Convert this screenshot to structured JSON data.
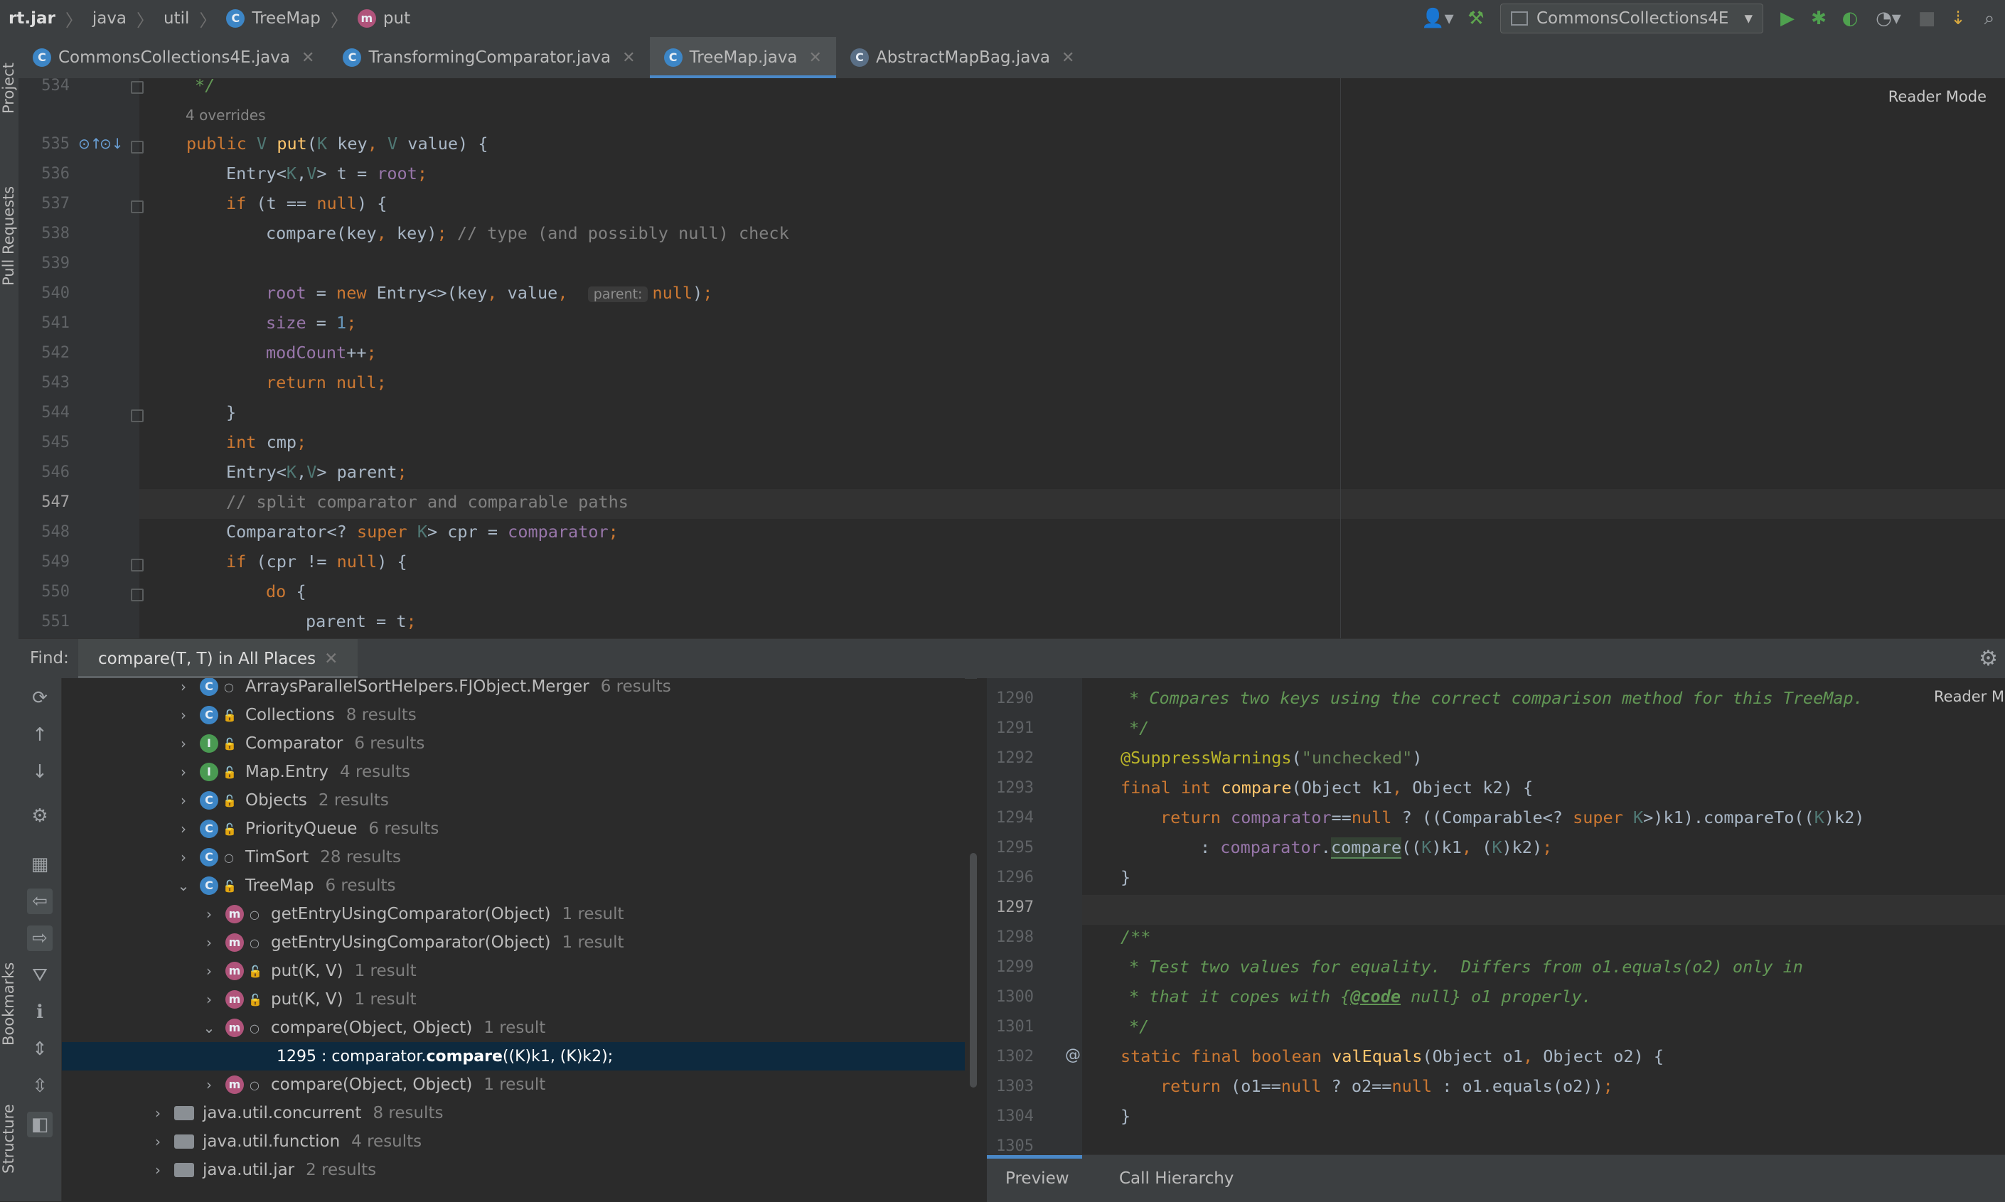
{
  "breadcrumbs": [
    "rt.jar",
    "java",
    "util",
    "TreeMap",
    "put"
  ],
  "breadcrumb_icons": {
    "TreeMap": "C",
    "put": "m"
  },
  "run_config": "CommonsCollections4E",
  "left_strip": {
    "project": "Project",
    "pull_requests": "Pull Requests",
    "bookmarks": "Bookmarks",
    "structure": "Structure"
  },
  "tabs": [
    {
      "label": "CommonsCollections4E.java",
      "active": false
    },
    {
      "label": "TransformingComparator.java",
      "active": false
    },
    {
      "label": "TreeMap.java",
      "active": true
    },
    {
      "label": "AbstractMapBag.java",
      "active": false
    }
  ],
  "editor": {
    "reader_mode": "Reader Mode",
    "overrides": "4 overrides",
    "current_line": "547",
    "lines": [
      {
        "n": "534",
        "code": "*/"
      },
      {
        "n": "535",
        "code": "public V put(K key, V value) {"
      },
      {
        "n": "536",
        "code": "Entry<K,V> t = root;"
      },
      {
        "n": "537",
        "code": "if (t == null) {"
      },
      {
        "n": "538",
        "code": "compare(key, key); // type (and possibly null) check"
      },
      {
        "n": "539",
        "code": ""
      },
      {
        "n": "540",
        "code": "root = new Entry<>(key, value, parent: null);"
      },
      {
        "n": "541",
        "code": "size = 1;"
      },
      {
        "n": "542",
        "code": "modCount++;"
      },
      {
        "n": "543",
        "code": "return null;"
      },
      {
        "n": "544",
        "code": "}"
      },
      {
        "n": "545",
        "code": "int cmp;"
      },
      {
        "n": "546",
        "code": "Entry<K,V> parent;"
      },
      {
        "n": "547",
        "code": "// split comparator and comparable paths"
      },
      {
        "n": "548",
        "code": "Comparator<? super K> cpr = comparator;"
      },
      {
        "n": "549",
        "code": "if (cpr != null) {"
      },
      {
        "n": "550",
        "code": "do {"
      },
      {
        "n": "551",
        "code": "parent = t;"
      }
    ],
    "param_hint": "parent:"
  },
  "find": {
    "label": "Find:",
    "tab": "compare(T, T) in All Places",
    "tree": [
      {
        "label": "ArraysParallelSortHelpers.FJObject.Merger",
        "count": "6 results",
        "kind": "c"
      },
      {
        "label": "Collections",
        "count": "8 results",
        "kind": "c"
      },
      {
        "label": "Comparator",
        "count": "6 results",
        "kind": "i"
      },
      {
        "label": "Map.Entry",
        "count": "4 results",
        "kind": "i"
      },
      {
        "label": "Objects",
        "count": "2 results",
        "kind": "c"
      },
      {
        "label": "PriorityQueue",
        "count": "6 results",
        "kind": "c"
      },
      {
        "label": "TimSort",
        "count": "28 results",
        "kind": "c"
      },
      {
        "label": "TreeMap",
        "count": "6 results",
        "kind": "c"
      },
      {
        "label": "getEntryUsingComparator(Object)",
        "count": "1 result",
        "kind": "m"
      },
      {
        "label": "getEntryUsingComparator(Object)",
        "count": "1 result",
        "kind": "m"
      },
      {
        "label": "put(K, V)",
        "count": "1 result",
        "kind": "m"
      },
      {
        "label": "put(K, V)",
        "count": "1 result",
        "kind": "m"
      },
      {
        "label": "compare(Object, Object)",
        "count": "1 result",
        "kind": "m"
      },
      {
        "label": "1295 : comparator.",
        "bold": "compare",
        "rest": "((K)k1, (K)k2);",
        "kind": "usage"
      },
      {
        "label": "compare(Object, Object)",
        "count": "1 result",
        "kind": "m"
      },
      {
        "label": "java.util.concurrent",
        "count": "8 results",
        "kind": "pkg"
      },
      {
        "label": "java.util.function",
        "count": "4 results",
        "kind": "pkg"
      },
      {
        "label": "java.util.jar",
        "count": "2 results",
        "kind": "pkg"
      }
    ]
  },
  "preview": {
    "reader_mode": "Reader Mode",
    "current_line": "1297",
    "lines": [
      {
        "n": "1290",
        "code": "* Compares two keys using the correct comparison method for this TreeMap."
      },
      {
        "n": "1291",
        "code": "*/"
      },
      {
        "n": "1292",
        "code": "@SuppressWarnings(\"unchecked\")"
      },
      {
        "n": "1293",
        "code": "final int compare(Object k1, Object k2) {"
      },
      {
        "n": "1294",
        "code": "return comparator==null ? ((Comparable<? super K>)k1).compareTo((K)k2)"
      },
      {
        "n": "1295",
        "code": ": comparator.compare((K)k1, (K)k2);"
      },
      {
        "n": "1296",
        "code": "}"
      },
      {
        "n": "1297",
        "code": ""
      },
      {
        "n": "1298",
        "code": "/**"
      },
      {
        "n": "1299",
        "code": "* Test two values for equality.  Differs from o1.equals(o2) only in"
      },
      {
        "n": "1300",
        "code": "* that it copes with {@code null} o1 properly."
      },
      {
        "n": "1301",
        "code": "*/"
      },
      {
        "n": "1302",
        "code": "static final boolean valEquals(Object o1, Object o2) {"
      },
      {
        "n": "1303",
        "code": "return (o1==null ? o2==null : o1.equals(o2));"
      },
      {
        "n": "1304",
        "code": "}"
      },
      {
        "n": "1305",
        "code": ""
      }
    ],
    "tabs": [
      "Preview",
      "Call Hierarchy"
    ]
  },
  "colors": {
    "accent": "#4a88c7",
    "selection": "#0d293e",
    "keyword": "#cc7832",
    "string": "#6a8759",
    "field": "#9876aa",
    "number": "#6897bb",
    "method": "#ffc66d",
    "annotation": "#bbb529"
  }
}
